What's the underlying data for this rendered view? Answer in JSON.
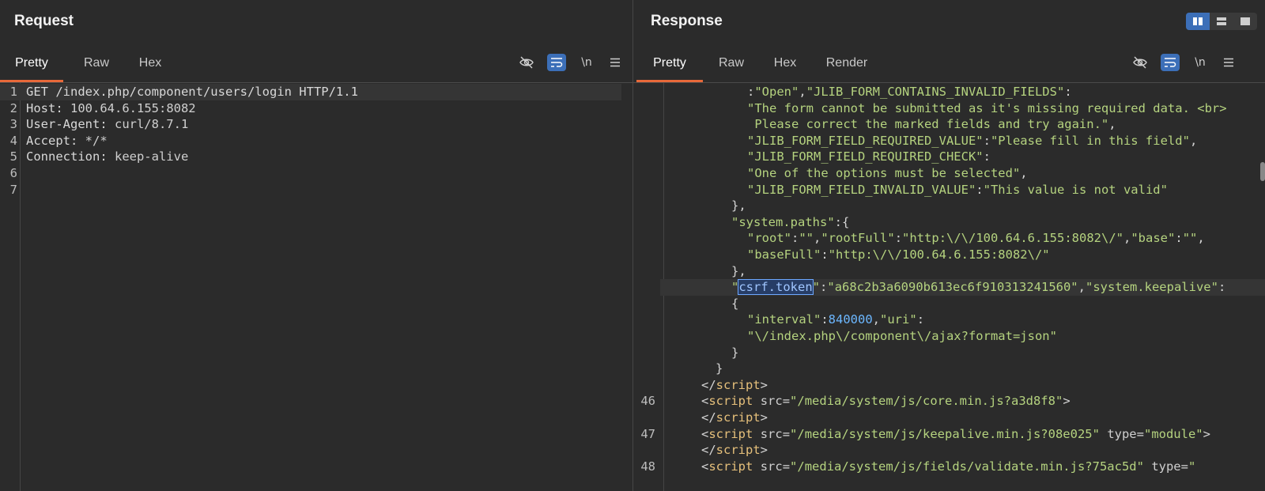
{
  "request": {
    "title": "Request",
    "tabs": [
      "Pretty",
      "Raw",
      "Hex"
    ],
    "active_tab": "Pretty",
    "newline_toggle": "\\n",
    "lines": [
      {
        "n": "1",
        "parts": [
          {
            "c": "k",
            "t": "GET /index.php/component/users/login HTTP/1.1"
          }
        ]
      },
      {
        "n": "2",
        "parts": [
          {
            "c": "k",
            "t": "Host: "
          },
          {
            "c": "v",
            "t": "100.64.6.155:8082"
          }
        ]
      },
      {
        "n": "3",
        "parts": [
          {
            "c": "k",
            "t": "User-Agent: "
          },
          {
            "c": "v",
            "t": "curl/8.7.1"
          }
        ]
      },
      {
        "n": "4",
        "parts": [
          {
            "c": "k",
            "t": "Accept: "
          },
          {
            "c": "v",
            "t": "*/*"
          }
        ]
      },
      {
        "n": "5",
        "parts": [
          {
            "c": "k",
            "t": "Connection: "
          },
          {
            "c": "v",
            "t": "keep-alive"
          }
        ]
      },
      {
        "n": "6",
        "parts": []
      },
      {
        "n": "7",
        "parts": []
      }
    ]
  },
  "response": {
    "title": "Response",
    "tabs": [
      "Pretty",
      "Raw",
      "Hex",
      "Render"
    ],
    "active_tab": "Pretty",
    "newline_toggle": "\\n",
    "lines": [
      {
        "n": "",
        "i": 104,
        "parts": [
          {
            "c": "p",
            "t": ":"
          },
          {
            "c": "s",
            "t": "\"Open\""
          },
          {
            "c": "p",
            "t": ","
          },
          {
            "c": "s",
            "t": "\"JLIB_FORM_CONTAINS_INVALID_FIELDS\""
          },
          {
            "c": "p",
            "t": ":"
          }
        ]
      },
      {
        "n": "",
        "i": 104,
        "parts": [
          {
            "c": "s",
            "t": "\"The form cannot be submitted as it's missing required data. <br>"
          }
        ]
      },
      {
        "n": "",
        "i": 104,
        "parts": [
          {
            "c": "s",
            "t": " Please correct the marked fields and try again.\""
          },
          {
            "c": "p",
            "t": ","
          }
        ]
      },
      {
        "n": "",
        "i": 104,
        "parts": [
          {
            "c": "s",
            "t": "\"JLIB_FORM_FIELD_REQUIRED_VALUE\""
          },
          {
            "c": "p",
            "t": ":"
          },
          {
            "c": "s",
            "t": "\"Please fill in this field\""
          },
          {
            "c": "p",
            "t": ","
          }
        ]
      },
      {
        "n": "",
        "i": 104,
        "parts": [
          {
            "c": "s",
            "t": "\"JLIB_FORM_FIELD_REQUIRED_CHECK\""
          },
          {
            "c": "p",
            "t": ":"
          }
        ]
      },
      {
        "n": "",
        "i": 104,
        "parts": [
          {
            "c": "s",
            "t": "\"One of the options must be selected\""
          },
          {
            "c": "p",
            "t": ","
          }
        ]
      },
      {
        "n": "",
        "i": 104,
        "parts": [
          {
            "c": "s",
            "t": "\"JLIB_FORM_FIELD_INVALID_VALUE\""
          },
          {
            "c": "p",
            "t": ":"
          },
          {
            "c": "s",
            "t": "\"This value is not valid\""
          }
        ]
      },
      {
        "n": "",
        "i": 84,
        "parts": [
          {
            "c": "p",
            "t": "},"
          }
        ]
      },
      {
        "n": "",
        "i": 84,
        "parts": [
          {
            "c": "s",
            "t": "\"system.paths\""
          },
          {
            "c": "p",
            "t": ":{"
          }
        ]
      },
      {
        "n": "",
        "i": 104,
        "parts": [
          {
            "c": "s",
            "t": "\"root\""
          },
          {
            "c": "p",
            "t": ":"
          },
          {
            "c": "s",
            "t": "\"\""
          },
          {
            "c": "p",
            "t": ","
          },
          {
            "c": "s",
            "t": "\"rootFull\""
          },
          {
            "c": "p",
            "t": ":"
          },
          {
            "c": "s",
            "t": "\"http:\\/\\/100.64.6.155:8082\\/\""
          },
          {
            "c": "p",
            "t": ","
          },
          {
            "c": "s",
            "t": "\"base\""
          },
          {
            "c": "p",
            "t": ":"
          },
          {
            "c": "s",
            "t": "\"\""
          },
          {
            "c": "p",
            "t": ","
          }
        ]
      },
      {
        "n": "",
        "i": 104,
        "parts": [
          {
            "c": "s",
            "t": "\"baseFull\""
          },
          {
            "c": "p",
            "t": ":"
          },
          {
            "c": "s",
            "t": "\"http:\\/\\/100.64.6.155:8082\\/\""
          }
        ]
      },
      {
        "n": "",
        "i": 84,
        "parts": [
          {
            "c": "p",
            "t": "},"
          }
        ]
      },
      {
        "n": "",
        "i": 84,
        "hl": true,
        "parts": [
          {
            "c": "s",
            "t": "\""
          },
          {
            "c": "sel",
            "t": "csrf.token"
          },
          {
            "c": "s",
            "t": "\""
          },
          {
            "c": "p",
            "t": ":"
          },
          {
            "c": "s",
            "t": "\"a68c2b3a6090b613ec6f910313241560\""
          },
          {
            "c": "p",
            "t": ","
          },
          {
            "c": "s",
            "t": "\"system.keepalive\""
          },
          {
            "c": "p",
            "t": ":"
          }
        ]
      },
      {
        "n": "",
        "i": 84,
        "parts": [
          {
            "c": "p",
            "t": "{"
          }
        ]
      },
      {
        "n": "",
        "i": 104,
        "parts": [
          {
            "c": "s",
            "t": "\"interval\""
          },
          {
            "c": "p",
            "t": ":"
          },
          {
            "c": "n",
            "t": "840000"
          },
          {
            "c": "p",
            "t": ","
          },
          {
            "c": "s",
            "t": "\"uri\""
          },
          {
            "c": "p",
            "t": ":"
          }
        ]
      },
      {
        "n": "",
        "i": 104,
        "parts": [
          {
            "c": "s",
            "t": "\"\\/index.php\\/component\\/ajax?format=json\""
          }
        ]
      },
      {
        "n": "",
        "i": 84,
        "parts": [
          {
            "c": "p",
            "t": "}"
          }
        ]
      },
      {
        "n": "",
        "i": 64,
        "parts": [
          {
            "c": "p",
            "t": "}"
          }
        ]
      },
      {
        "n": "",
        "i": 46,
        "parts": [
          {
            "c": "p",
            "t": "</"
          },
          {
            "c": "t",
            "t": "script"
          },
          {
            "c": "p",
            "t": ">"
          }
        ]
      },
      {
        "n": "46",
        "i": 46,
        "parts": [
          {
            "c": "p",
            "t": "<"
          },
          {
            "c": "t",
            "t": "script"
          },
          {
            "c": "p",
            "t": " "
          },
          {
            "c": "v",
            "t": "src"
          },
          {
            "c": "p",
            "t": "="
          },
          {
            "c": "s",
            "t": "\"/media/system/js/core.min.js?a3d8f8\""
          },
          {
            "c": "p",
            "t": ">"
          }
        ]
      },
      {
        "n": "",
        "i": 46,
        "parts": [
          {
            "c": "p",
            "t": "</"
          },
          {
            "c": "t",
            "t": "script"
          },
          {
            "c": "p",
            "t": ">"
          }
        ]
      },
      {
        "n": "47",
        "i": 46,
        "parts": [
          {
            "c": "p",
            "t": "<"
          },
          {
            "c": "t",
            "t": "script"
          },
          {
            "c": "p",
            "t": " "
          },
          {
            "c": "v",
            "t": "src"
          },
          {
            "c": "p",
            "t": "="
          },
          {
            "c": "s",
            "t": "\"/media/system/js/keepalive.min.js?08e025\""
          },
          {
            "c": "p",
            "t": " "
          },
          {
            "c": "v",
            "t": "type"
          },
          {
            "c": "p",
            "t": "="
          },
          {
            "c": "s",
            "t": "\"module\""
          },
          {
            "c": "p",
            "t": ">"
          }
        ]
      },
      {
        "n": "",
        "i": 46,
        "parts": [
          {
            "c": "p",
            "t": "</"
          },
          {
            "c": "t",
            "t": "script"
          },
          {
            "c": "p",
            "t": ">"
          }
        ]
      },
      {
        "n": "48",
        "i": 46,
        "parts": [
          {
            "c": "p",
            "t": "<"
          },
          {
            "c": "t",
            "t": "script"
          },
          {
            "c": "p",
            "t": " "
          },
          {
            "c": "v",
            "t": "src"
          },
          {
            "c": "p",
            "t": "="
          },
          {
            "c": "s",
            "t": "\"/media/system/js/fields/validate.min.js?75ac5d\""
          },
          {
            "c": "p",
            "t": " "
          },
          {
            "c": "v",
            "t": "type"
          },
          {
            "c": "p",
            "t": "="
          },
          {
            "c": "s",
            "t": "\""
          }
        ]
      }
    ]
  },
  "icons": {
    "hide": "eye-slash-icon",
    "wrap": "wrap-lines-icon",
    "menu": "hamburger-menu-icon",
    "layout_split": "split-columns-icon",
    "layout_rows": "split-rows-icon",
    "layout_single": "single-pane-icon"
  },
  "colors": {
    "accent": "#e8693a",
    "toggle_on": "#3c6fb8",
    "string": "#b5d37f",
    "tag": "#e6c07b",
    "number": "#6cb7ff"
  }
}
